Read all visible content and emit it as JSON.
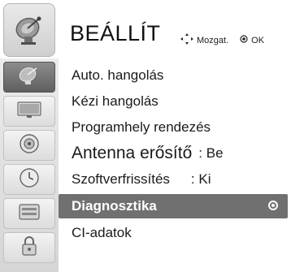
{
  "header": {
    "title": "BEÁLLÍT",
    "icon": "satellite-dish-icon",
    "hint_move_label": "Mozgat.",
    "hint_ok_label": "OK"
  },
  "sidebar": {
    "items": [
      {
        "icon": "satellite-dish-icon",
        "active": true
      },
      {
        "icon": "monitor-icon",
        "active": false
      },
      {
        "icon": "speaker-icon",
        "active": false
      },
      {
        "icon": "clock-icon",
        "active": false
      },
      {
        "icon": "settings-box-icon",
        "active": false
      },
      {
        "icon": "lock-icon",
        "active": false
      }
    ]
  },
  "menu": {
    "items": [
      {
        "label": "Auto. hangolás"
      },
      {
        "label": "Kézi hangolás"
      },
      {
        "label": "Programhely rendezés"
      },
      {
        "label": "Antenna erősítő",
        "value": ": Be"
      },
      {
        "label": "Szoftverfrissítés",
        "value": ": Ki"
      },
      {
        "label": "Diagnosztika",
        "selected": true
      },
      {
        "label": "CI-adatok"
      }
    ]
  },
  "colors": {
    "selected_bg": "#707070",
    "active_sidebar": "#6e6e6e"
  }
}
